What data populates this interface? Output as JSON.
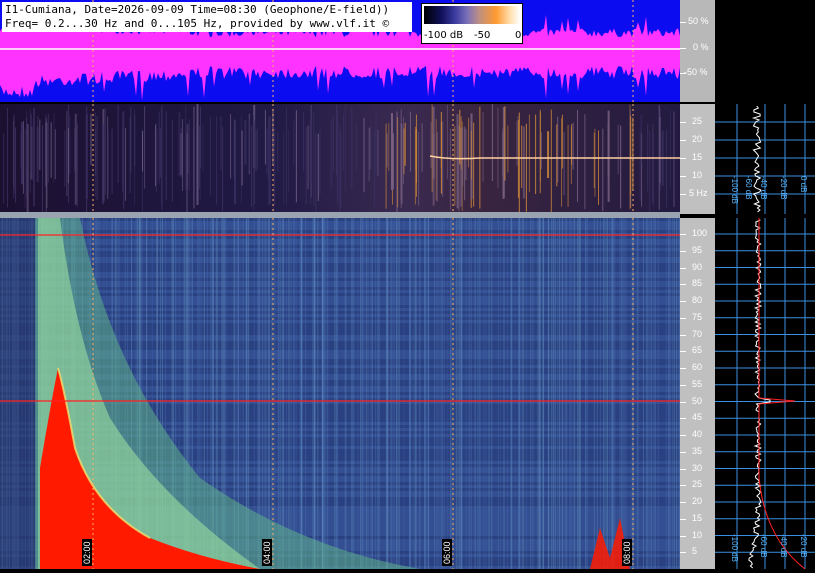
{
  "header": {
    "line1": "I1-Cumiana, Date=2026-09-09 Time=08:30 (Geophone/E-field))",
    "line2": "Freq= 0.2...30 Hz and 0...105 Hz, provided by www.vlf.it ©"
  },
  "colorbar": {
    "labels": [
      "-100 dB",
      "-50",
      "0"
    ]
  },
  "wave_axis": {
    "ticks": [
      "50 %",
      "0 %",
      "-50 %"
    ]
  },
  "spec1_axis": {
    "ticks": [
      "25",
      "20",
      "15",
      "10",
      "5 Hz"
    ]
  },
  "spec2_axis": {
    "ticks": [
      "100",
      "95",
      "90",
      "85",
      "80",
      "75",
      "70",
      "65",
      "60",
      "55",
      "50",
      "45",
      "40",
      "35",
      "30",
      "25",
      "20",
      "15",
      "10",
      "5"
    ]
  },
  "time_labels": [
    "02:00",
    "04:00",
    "06:00",
    "08:00"
  ],
  "profile1_labels": [
    "-100 dB",
    "-60 dB",
    "-40 dB",
    "-20 dB",
    "0 dB"
  ],
  "profile2_labels": [
    "-100 dB",
    "-60 dB",
    "-40 dB",
    "-20 dB"
  ],
  "colors": {
    "waveform_bg": "#0c0cf0",
    "waveform_trace": "#ff33ff",
    "spectrogram_bg": "#2a3f7d",
    "intensity_high": "#ff1a00",
    "axis_gray": "#c0c0c0",
    "profile_grid": "#4aa8ff"
  }
}
